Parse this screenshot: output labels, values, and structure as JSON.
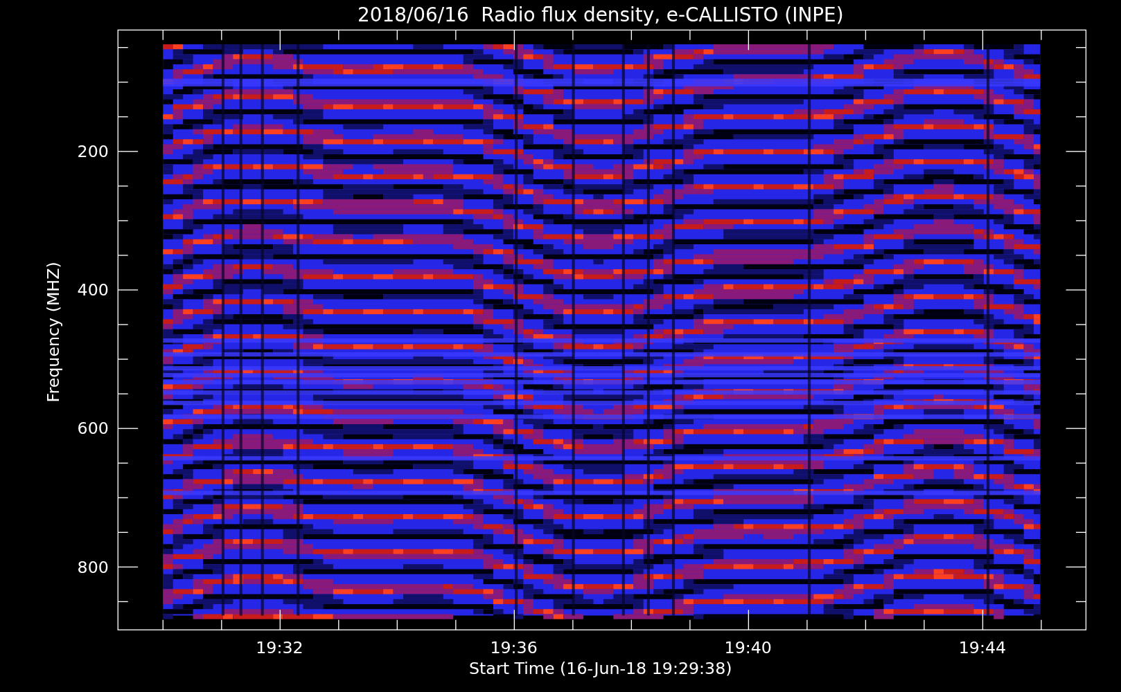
{
  "title": "2018/06/16  Radio flux density, e-CALLISTO (INPE)",
  "plot": {
    "ylabel": "Frequency (MHZ)",
    "xlabel": "Start Time (16-Jun-18 19:29:38)",
    "yticks": [
      "200",
      "400",
      "600",
      "800"
    ],
    "xticks": [
      "19:32",
      "19:36",
      "19:40",
      "19:44"
    ]
  }
}
